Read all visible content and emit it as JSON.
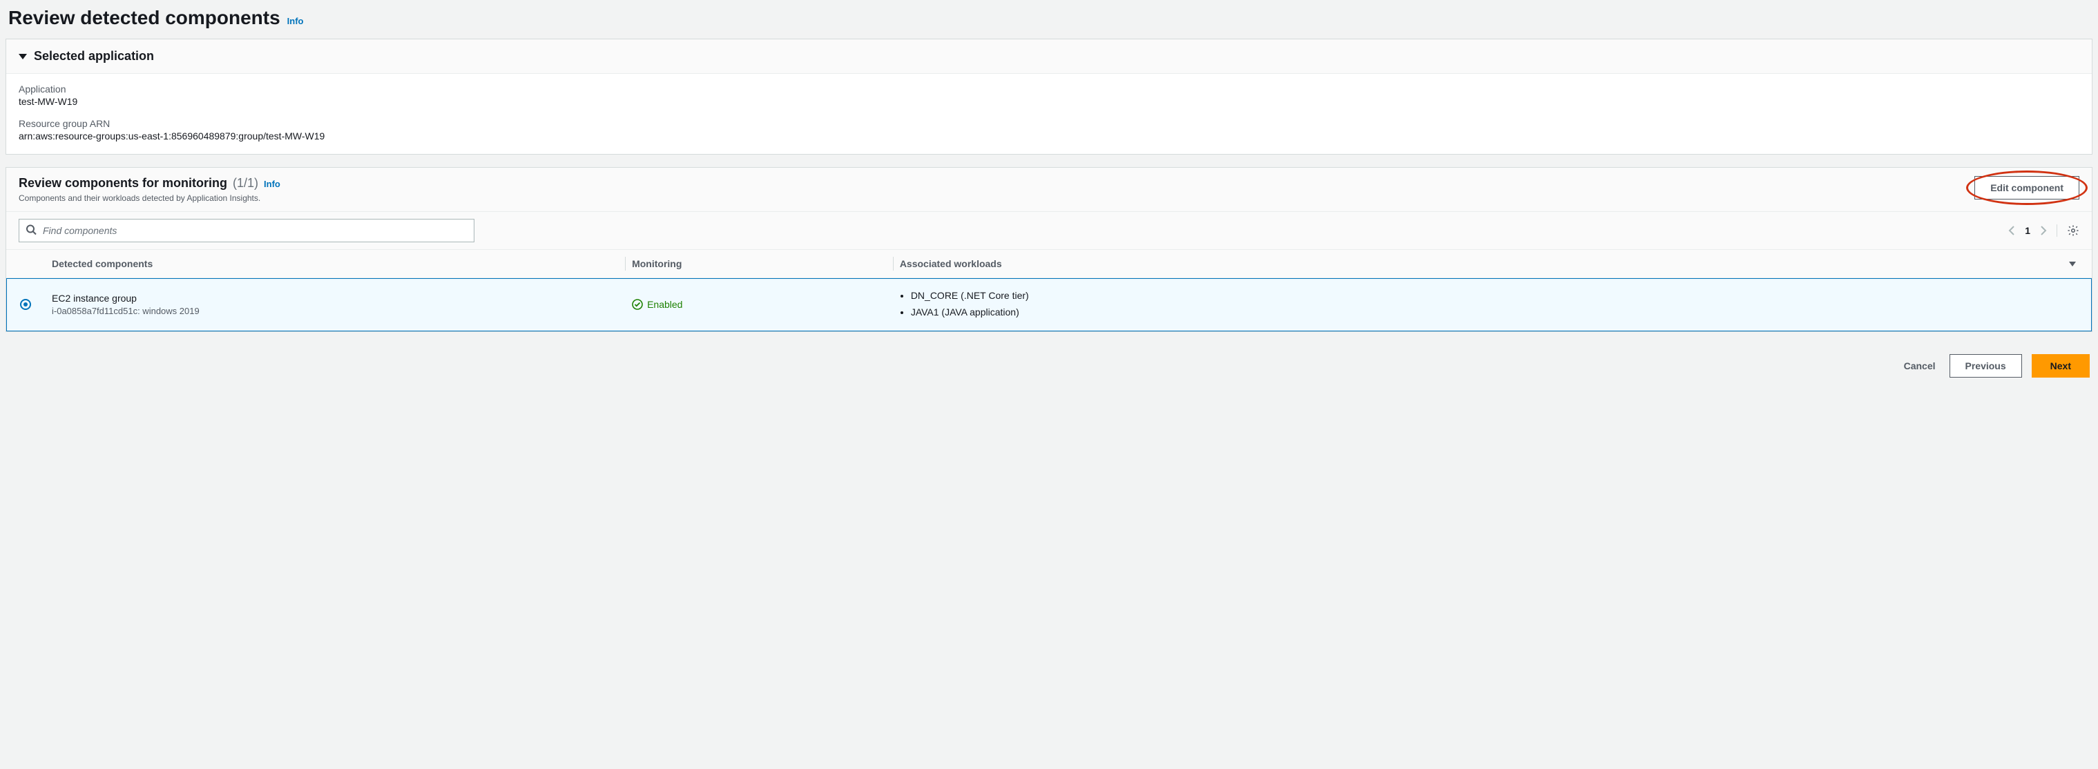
{
  "page": {
    "title": "Review detected components",
    "info": "Info"
  },
  "selected_app": {
    "header": "Selected application",
    "application_label": "Application",
    "application_value": "test-MW-W19",
    "arn_label": "Resource group ARN",
    "arn_value": "arn:aws:resource-groups:us-east-1:856960489879:group/test-MW-W19"
  },
  "components_panel": {
    "title": "Review components for monitoring",
    "count": "(1/1)",
    "info": "Info",
    "subtitle": "Components and their workloads detected by Application Insights.",
    "edit_button": "Edit component",
    "search_placeholder": "Find components",
    "pagination": {
      "current": "1"
    },
    "columns": {
      "detected": "Detected components",
      "monitoring": "Monitoring",
      "workloads": "Associated workloads"
    },
    "rows": [
      {
        "title": "EC2 instance group",
        "subtitle": "i-0a0858a7fd11cd51c: windows 2019",
        "monitoring": "Enabled",
        "workloads": [
          "DN_CORE (.NET Core tier)",
          "JAVA1 (JAVA application)"
        ]
      }
    ]
  },
  "footer": {
    "cancel": "Cancel",
    "previous": "Previous",
    "next": "Next"
  }
}
